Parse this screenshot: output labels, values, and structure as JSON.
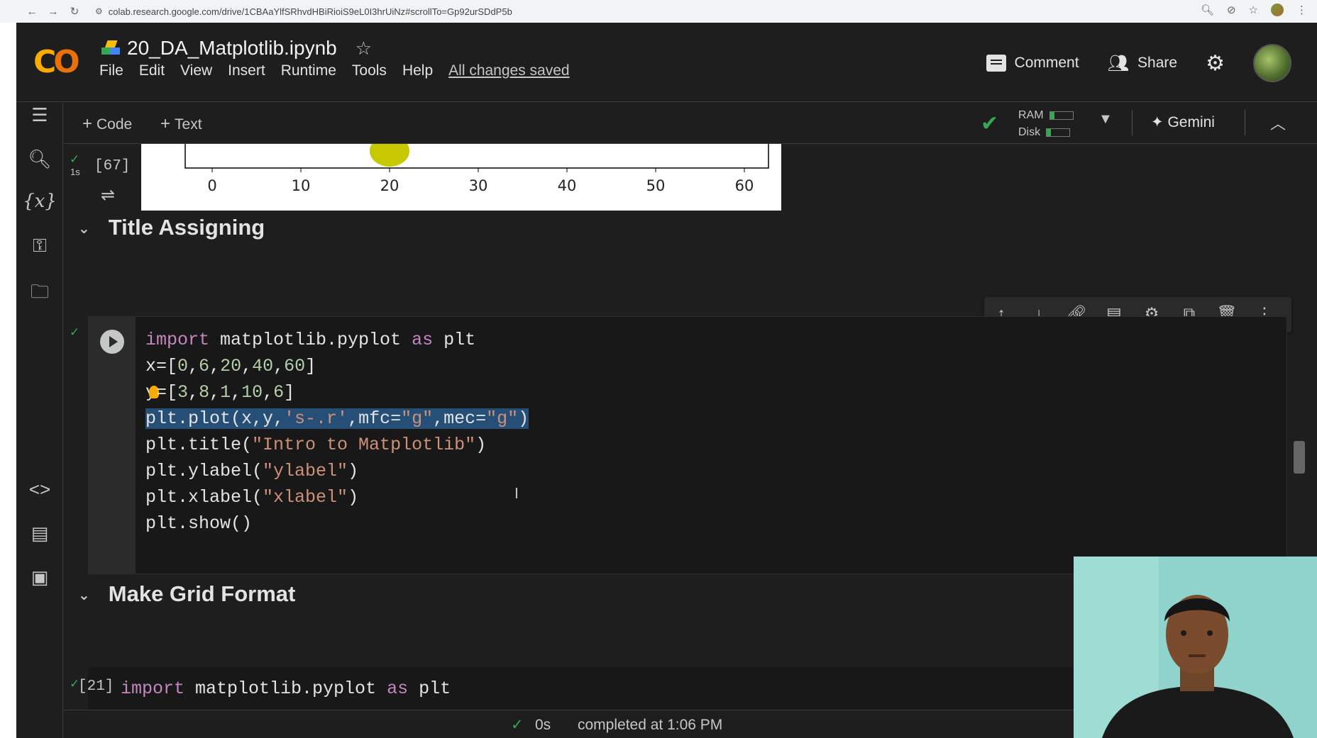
{
  "browser": {
    "url": "colab.research.google.com/drive/1CBAaYlfSRhvdHBiRioiS9eL0I3hrUiNz#scrollTo=Gp92urSDdP5b"
  },
  "header": {
    "notebook_title": "20_DA_Matplotlib.ipynb",
    "menu": [
      "File",
      "Edit",
      "View",
      "Insert",
      "Runtime",
      "Tools",
      "Help"
    ],
    "save_status": "All changes saved",
    "comment_label": "Comment",
    "share_label": "Share"
  },
  "toolbar": {
    "add_code": "Code",
    "add_text": "Text",
    "ram_label": "RAM",
    "disk_label": "Disk",
    "gemini_label": "Gemini"
  },
  "previous_cell": {
    "exec_count": "[67]",
    "duration": "1s",
    "plot": {
      "x_tick_labels": [
        "0",
        "10",
        "20",
        "30",
        "40",
        "50",
        "60"
      ]
    }
  },
  "sections": {
    "title_assigning": "Title Assigning",
    "make_grid_format": "Make Grid Format"
  },
  "code_cell": {
    "lines": [
      "import matplotlib.pyplot as plt",
      "x=[0,6,20,40,60]",
      "y=[3,8,1,10,6]",
      "plt.plot(x,y,'s-.r',mfc=\"g\",mec=\"g\")",
      "plt.title(\"Intro to Matplotlib\")",
      "plt.ylabel(\"ylabel\")",
      "plt.xlabel(\"xlabel\")",
      "plt.show()"
    ]
  },
  "next_cell": {
    "exec_count": "[21]",
    "first_line": "import matplotlib.pyplot as plt"
  },
  "status_bar": {
    "duration": "0s",
    "message": "completed at 1:06 PM"
  },
  "colors": {
    "accent_green": "#34a853",
    "logo_orange": "#f9ab00",
    "selection": "#264f78"
  }
}
